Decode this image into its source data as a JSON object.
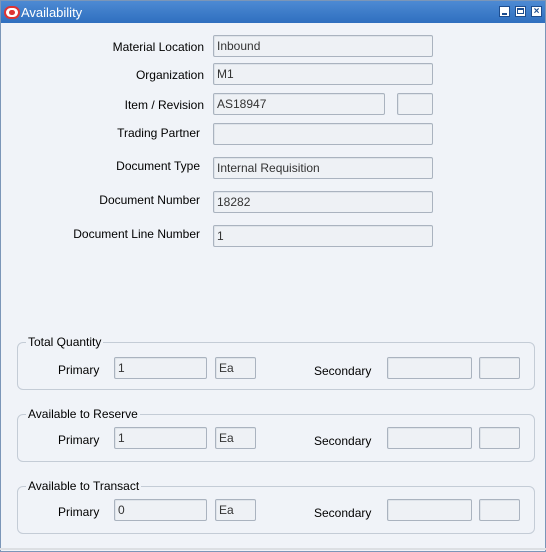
{
  "window": {
    "title": "Availability"
  },
  "form": {
    "material_location": {
      "label": "Material Location",
      "value": "Inbound"
    },
    "organization": {
      "label": "Organization",
      "value": "M1"
    },
    "item_revision": {
      "label": "Item / Revision",
      "item_value": "AS18947",
      "revision_value": ""
    },
    "trading_partner": {
      "label": "Trading Partner",
      "value": ""
    },
    "document_type": {
      "label": "Document Type",
      "value": "Internal Requisition"
    },
    "document_number": {
      "label": "Document Number",
      "value": "18282"
    },
    "document_line_number": {
      "label": "Document Line Number",
      "value": "1"
    }
  },
  "quantities": {
    "primary_label": "Primary",
    "secondary_label": "Secondary",
    "total": {
      "title": "Total Quantity",
      "primary_value": "1",
      "primary_uom": "Ea",
      "secondary_value": "",
      "secondary_uom": ""
    },
    "reserve": {
      "title": "Available to Reserve",
      "primary_value": "1",
      "primary_uom": "Ea",
      "secondary_value": "",
      "secondary_uom": ""
    },
    "transact": {
      "title": "Available to Transact",
      "primary_value": "0",
      "primary_uom": "Ea",
      "secondary_value": "",
      "secondary_uom": ""
    }
  },
  "colors": {
    "titlebar": "#2f6fbf",
    "window_bg": "#f0f3f8",
    "field_bg": "#eef1f5"
  }
}
